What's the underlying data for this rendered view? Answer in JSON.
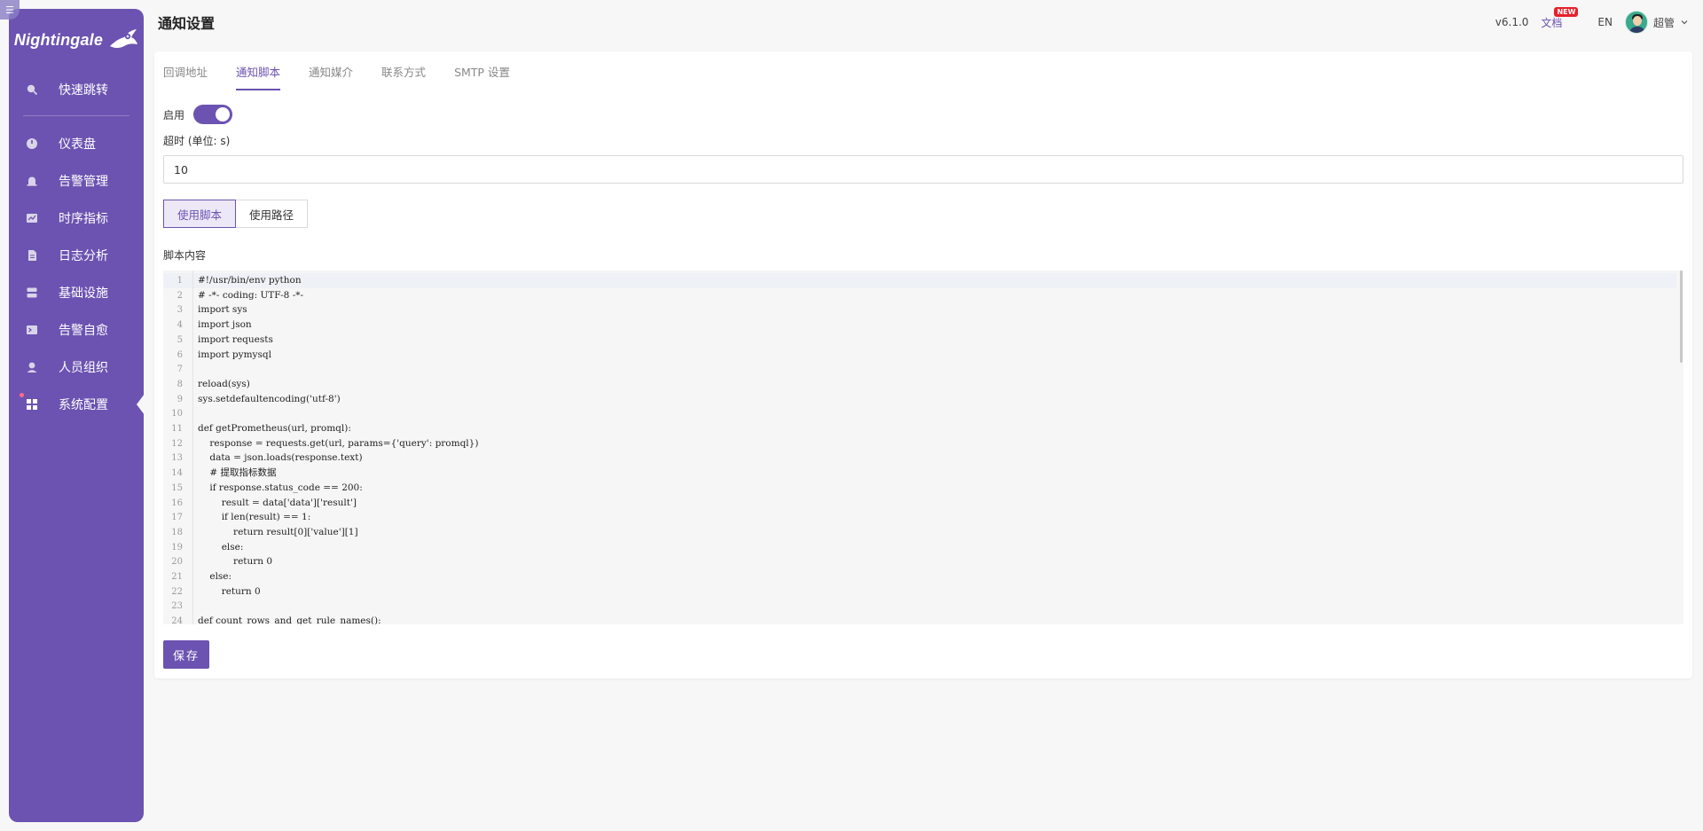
{
  "brand": {
    "name": "Nightingale"
  },
  "sidebar": {
    "items": [
      {
        "label": "快速跳转",
        "icon": "search-icon"
      },
      {
        "label": "仪表盘",
        "icon": "dashboard-icon"
      },
      {
        "label": "告警管理",
        "icon": "alarm-bell-icon"
      },
      {
        "label": "时序指标",
        "icon": "line-chart-icon"
      },
      {
        "label": "日志分析",
        "icon": "log-file-icon"
      },
      {
        "label": "基础设施",
        "icon": "server-icon"
      },
      {
        "label": "告警自愈",
        "icon": "terminal-icon"
      },
      {
        "label": "人员组织",
        "icon": "user-icon"
      },
      {
        "label": "系统配置",
        "icon": "apps-grid-icon",
        "active": true
      }
    ]
  },
  "header": {
    "title": "通知设置",
    "version": "v6.1.0",
    "docs_label": "文档",
    "new_badge": "NEW",
    "lang": "EN",
    "username": "超管",
    "dropdown_icon": "chevron-down-icon"
  },
  "tabs": [
    "回调地址",
    "通知脚本",
    "通知媒介",
    "联系方式",
    "SMTP 设置"
  ],
  "active_tab": "通知脚本",
  "form": {
    "enable_label": "启用",
    "enabled": true,
    "timeout_label": "超时 (单位: s)",
    "timeout_value": "10",
    "mode_options": [
      "使用脚本",
      "使用路径"
    ],
    "mode_selected": "使用脚本",
    "script_label": "脚本内容",
    "save_label": "保存"
  },
  "editor": {
    "lines": [
      "#!/usr/bin/env python",
      "# -*- coding: UTF-8 -*-",
      "import sys",
      "import json",
      "import requests",
      "import pymysql",
      "",
      "reload(sys)",
      "sys.setdefaultencoding('utf-8')",
      "",
      "def getPrometheus(url, promql):",
      "    response = requests.get(url, params={'query': promql})",
      "    data = json.loads(response.text)",
      "    # 提取指标数据",
      "    if response.status_code == 200:",
      "        result = data['data']['result']",
      "        if len(result) == 1:",
      "            return result[0]['value'][1]",
      "        else:",
      "            return 0",
      "    else:",
      "        return 0",
      "",
      "def count_rows_and_get_rule_names():"
    ]
  },
  "colors": {
    "brand": "#6c53b1",
    "new_badge": "#e8202a"
  }
}
